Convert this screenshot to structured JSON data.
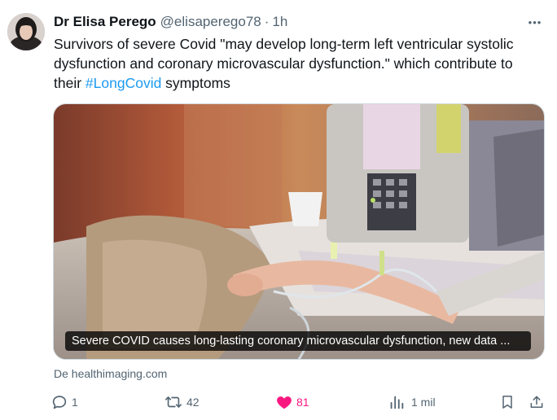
{
  "author": {
    "name": "Dr Elisa Perego",
    "handle": "@elisaperego78",
    "separator": "·",
    "time": "1h"
  },
  "more_label": "•••",
  "post": {
    "text_before": "Survivors of severe Covid \"may develop long-term left ventricular systolic dysfunction and coronary microvascular dysfunction.\" which contribute to their ",
    "hashtag": "#LongCovid",
    "text_after": " symptoms"
  },
  "card": {
    "caption": "Severe COVID causes long-lasting coronary microvascular dysfunction, new data ...",
    "source": "De healthimaging.com"
  },
  "actions": {
    "replies": "1",
    "reposts": "42",
    "likes": "81",
    "views": "1 mil"
  },
  "icons": [
    "reply-icon",
    "repost-icon",
    "heart-icon",
    "views-icon",
    "bookmark-icon",
    "share-icon"
  ],
  "colors": {
    "accent": "#1d9bf0",
    "like": "#f91880",
    "muted": "#536471"
  }
}
